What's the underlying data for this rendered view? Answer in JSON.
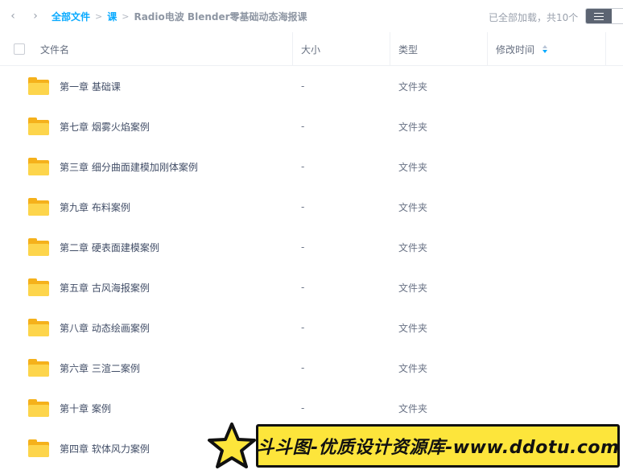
{
  "toolbar": {
    "back_glyph": "‹",
    "forward_glyph": "›",
    "breadcrumb": {
      "root": "全部文件",
      "parent": "课",
      "separator": ">",
      "current": "Radio电波 Blender零基础动态海报课"
    },
    "load_status": "已全部加载，共10个",
    "view_mode": "list"
  },
  "table": {
    "columns": {
      "name": "文件名",
      "size": "大小",
      "type": "类型",
      "modified": "修改时间"
    },
    "sort": {
      "column": "modified",
      "direction": "descending"
    },
    "rows": [
      {
        "name": "第一章 基础课",
        "size": "-",
        "type": "文件夹",
        "modified": ""
      },
      {
        "name": "第七章 烟雾火焰案例",
        "size": "-",
        "type": "文件夹",
        "modified": ""
      },
      {
        "name": "第三章 细分曲面建模加刚体案例",
        "size": "-",
        "type": "文件夹",
        "modified": ""
      },
      {
        "name": "第九章 布料案例",
        "size": "-",
        "type": "文件夹",
        "modified": ""
      },
      {
        "name": "第二章 硬表面建模案例",
        "size": "-",
        "type": "文件夹",
        "modified": ""
      },
      {
        "name": "第五章 古风海报案例",
        "size": "-",
        "type": "文件夹",
        "modified": ""
      },
      {
        "name": "第八章 动态绘画案例",
        "size": "-",
        "type": "文件夹",
        "modified": ""
      },
      {
        "name": "第六章 三渲二案例",
        "size": "-",
        "type": "文件夹",
        "modified": ""
      },
      {
        "name": "第十章 案例",
        "size": "-",
        "type": "文件夹",
        "modified": ""
      },
      {
        "name": "第四章 软体风力案例",
        "size": "-",
        "type": "文件夹",
        "modified": ""
      }
    ]
  },
  "watermark": {
    "text": "斗斗图-优质设计资源库-www.ddotu.com",
    "icon": "star-icon"
  },
  "colors": {
    "accent": "#09aaff",
    "folder_back": "#f5b11b",
    "folder_front": "#fdd54c",
    "banner_bg": "#fde53b"
  }
}
